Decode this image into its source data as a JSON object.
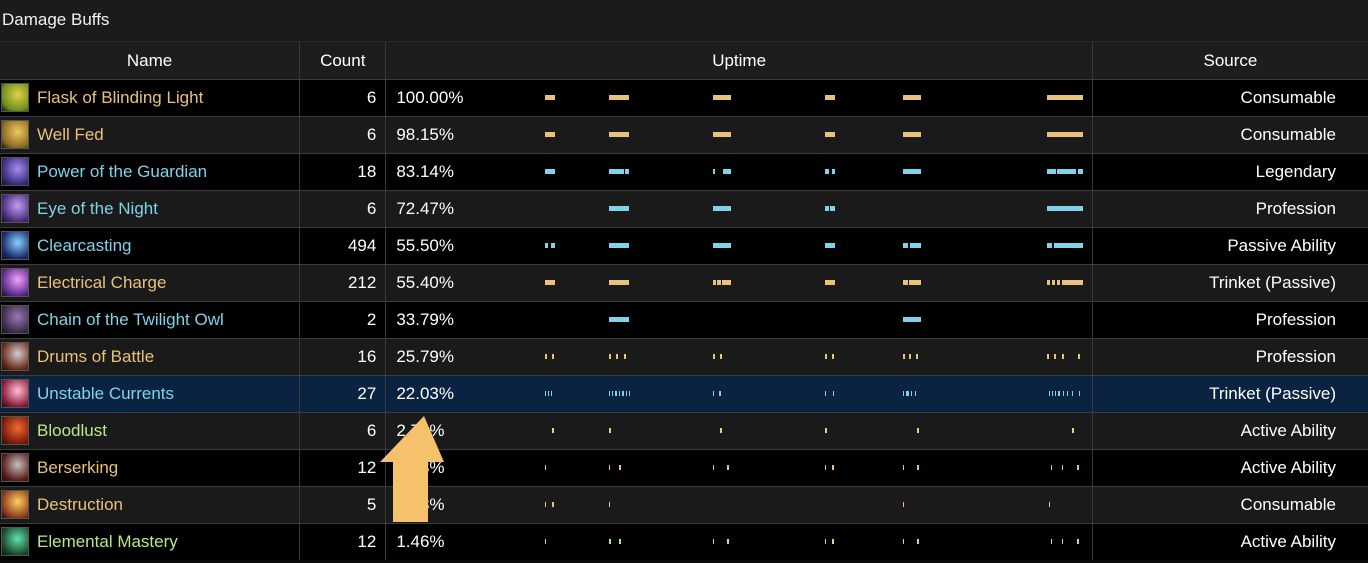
{
  "panel": {
    "title": "Damage Buffs"
  },
  "headers": {
    "name": "Name",
    "count": "Count",
    "uptime": "Uptime",
    "source": "Source"
  },
  "colors": {
    "gold": "#e8c27a",
    "cyan": "#7fd3ea",
    "green": "#b9e88a",
    "selected_row": "#0b2342",
    "arrow": "#f5c26b"
  },
  "rows": [
    {
      "name": "Flask of Blinding Light",
      "count": "6",
      "uptime": "100.00%",
      "source": "Consumable",
      "color": "gold",
      "icon": "flask-icon",
      "icon_colors": [
        "#6b8f1a",
        "#e2d04a"
      ],
      "segs": [
        [
          159,
          169
        ],
        [
          223,
          243
        ],
        [
          327,
          345
        ],
        [
          439,
          449
        ],
        [
          517,
          535
        ],
        [
          661,
          697
        ]
      ]
    },
    {
      "name": "Well Fed",
      "count": "6",
      "uptime": "98.15%",
      "source": "Consumable",
      "color": "gold",
      "icon": "food-icon",
      "icon_colors": [
        "#8a6a20",
        "#f0c860"
      ],
      "segs": [
        [
          159,
          169
        ],
        [
          223,
          243
        ],
        [
          327,
          345
        ],
        [
          439,
          449
        ],
        [
          517,
          535
        ],
        [
          661,
          697
        ]
      ]
    },
    {
      "name": "Power of the Guardian",
      "count": "18",
      "uptime": "83.14%",
      "source": "Legendary",
      "color": "cyan",
      "icon": "guardian-icon",
      "icon_colors": [
        "#3a2a7a",
        "#a78cf0"
      ],
      "segs": [
        [
          159,
          169
        ],
        [
          223,
          238
        ],
        [
          239,
          243
        ],
        [
          327,
          329
        ],
        [
          337,
          345
        ],
        [
          439,
          443
        ],
        [
          446,
          449
        ],
        [
          517,
          535
        ],
        [
          661,
          670
        ],
        [
          671,
          690
        ],
        [
          692,
          697
        ]
      ]
    },
    {
      "name": "Eye of the Night",
      "count": "6",
      "uptime": "72.47%",
      "source": "Profession",
      "color": "cyan",
      "icon": "gem-icon",
      "icon_colors": [
        "#4a2a7a",
        "#c0a0f0"
      ],
      "segs": [
        [
          223,
          243
        ],
        [
          327,
          345
        ],
        [
          439,
          443
        ],
        [
          444,
          449
        ],
        [
          661,
          697
        ]
      ]
    },
    {
      "name": "Clearcasting",
      "count": "494",
      "uptime": "55.50%",
      "source": "Passive Ability",
      "color": "cyan",
      "icon": "lightning-icon",
      "icon_colors": [
        "#1a2a6a",
        "#8ad0ff"
      ],
      "segs": [
        [
          159,
          162
        ],
        [
          165,
          169
        ],
        [
          223,
          243
        ],
        [
          327,
          345
        ],
        [
          439,
          449
        ],
        [
          517,
          522
        ],
        [
          524,
          535
        ],
        [
          661,
          666
        ],
        [
          668,
          697
        ]
      ]
    },
    {
      "name": "Electrical Charge",
      "count": "212",
      "uptime": "55.40%",
      "source": "Trinket (Passive)",
      "color": "gold",
      "icon": "spark-icon",
      "icon_colors": [
        "#5a2a8a",
        "#f0a0ff"
      ],
      "segs": [
        [
          159,
          169
        ],
        [
          223,
          243
        ],
        [
          327,
          330
        ],
        [
          331,
          335
        ],
        [
          336,
          345
        ],
        [
          439,
          449
        ],
        [
          517,
          522
        ],
        [
          523,
          535
        ],
        [
          661,
          664
        ],
        [
          666,
          669
        ],
        [
          671,
          674
        ],
        [
          676,
          697
        ]
      ]
    },
    {
      "name": "Chain of the Twilight Owl",
      "count": "2",
      "uptime": "33.79%",
      "source": "Profession",
      "color": "cyan",
      "icon": "feather-icon",
      "icon_colors": [
        "#3a2a4a",
        "#9a7ab0"
      ],
      "segs": [
        [
          223,
          243
        ],
        [
          517,
          535
        ]
      ]
    },
    {
      "name": "Drums of Battle",
      "count": "16",
      "uptime": "25.79%",
      "source": "Profession",
      "color": "gold",
      "icon": "drum-icon",
      "icon_colors": [
        "#6a2a1a",
        "#d0d0d0"
      ],
      "segs": [
        [
          159,
          161
        ],
        [
          166,
          168
        ],
        [
          223,
          225
        ],
        [
          230,
          232
        ],
        [
          238,
          240
        ],
        [
          327,
          329
        ],
        [
          334,
          336
        ],
        [
          439,
          441
        ],
        [
          446,
          448
        ],
        [
          517,
          519
        ],
        [
          523,
          525
        ],
        [
          530,
          532
        ],
        [
          661,
          663
        ],
        [
          668,
          670
        ],
        [
          676,
          678
        ],
        [
          692,
          694
        ]
      ]
    },
    {
      "name": "Unstable Currents",
      "count": "27",
      "uptime": "22.03%",
      "source": "Trinket (Passive)",
      "color": "cyan",
      "icon": "currents-icon",
      "icon_colors": [
        "#8a1a3a",
        "#ffc0d0"
      ],
      "segs": [
        [
          159,
          160
        ],
        [
          162,
          163
        ],
        [
          165,
          166
        ],
        [
          223,
          224
        ],
        [
          226,
          227
        ],
        [
          229,
          231
        ],
        [
          233,
          234
        ],
        [
          236,
          238
        ],
        [
          240,
          241
        ],
        [
          243,
          244
        ],
        [
          327,
          328
        ],
        [
          333,
          335
        ],
        [
          439,
          440
        ],
        [
          447,
          448
        ],
        [
          517,
          518
        ],
        [
          520,
          523
        ],
        [
          525,
          526
        ],
        [
          529,
          530
        ],
        [
          663,
          664
        ],
        [
          666,
          667
        ],
        [
          669,
          670
        ],
        [
          672,
          674
        ],
        [
          677,
          678
        ],
        [
          681,
          682
        ],
        [
          686,
          687
        ],
        [
          693,
          694
        ]
      ]
    },
    {
      "name": "Bloodlust",
      "count": "6",
      "uptime": "2.70%",
      "source": "Active Ability",
      "color": "green",
      "icon": "bloodlust-icon",
      "icon_colors": [
        "#7a1a0a",
        "#f06a30"
      ],
      "segs": [
        [
          166,
          168
        ],
        [
          223,
          225
        ],
        [
          334,
          336
        ],
        [
          439,
          441
        ],
        [
          531,
          533
        ],
        [
          686,
          688
        ]
      ]
    },
    {
      "name": "Berserking",
      "count": "12",
      "uptime": "2.53%",
      "source": "Active Ability",
      "color": "gold",
      "icon": "berserk-icon",
      "icon_colors": [
        "#5a1a1a",
        "#c0c0c0"
      ],
      "segs": [
        [
          159,
          160
        ],
        [
          223,
          224
        ],
        [
          233,
          235
        ],
        [
          327,
          328
        ],
        [
          341,
          343
        ],
        [
          439,
          440
        ],
        [
          446,
          448
        ],
        [
          517,
          518
        ],
        [
          531,
          533
        ],
        [
          665,
          666
        ],
        [
          676,
          677
        ],
        [
          691,
          693
        ]
      ]
    },
    {
      "name": "Destruction",
      "count": "5",
      "uptime": "2.08%",
      "source": "Consumable",
      "color": "gold",
      "icon": "potion-icon",
      "icon_colors": [
        "#8a3a1a",
        "#ffd060"
      ],
      "segs": [
        [
          159,
          160
        ],
        [
          166,
          168
        ],
        [
          223,
          224
        ],
        [
          517,
          518
        ],
        [
          663,
          664
        ]
      ]
    },
    {
      "name": "Elemental Mastery",
      "count": "12",
      "uptime": "1.46%",
      "source": "Active Ability",
      "color": "green",
      "icon": "mastery-icon",
      "icon_colors": [
        "#1a4a2a",
        "#60e0b0"
      ],
      "segs": [
        [
          159,
          160
        ],
        [
          223,
          225
        ],
        [
          233,
          235
        ],
        [
          327,
          328
        ],
        [
          341,
          343
        ],
        [
          439,
          440
        ],
        [
          446,
          448
        ],
        [
          517,
          518
        ],
        [
          531,
          533
        ],
        [
          665,
          666
        ],
        [
          676,
          677
        ],
        [
          691,
          693
        ]
      ]
    }
  ],
  "selected_row": 8
}
